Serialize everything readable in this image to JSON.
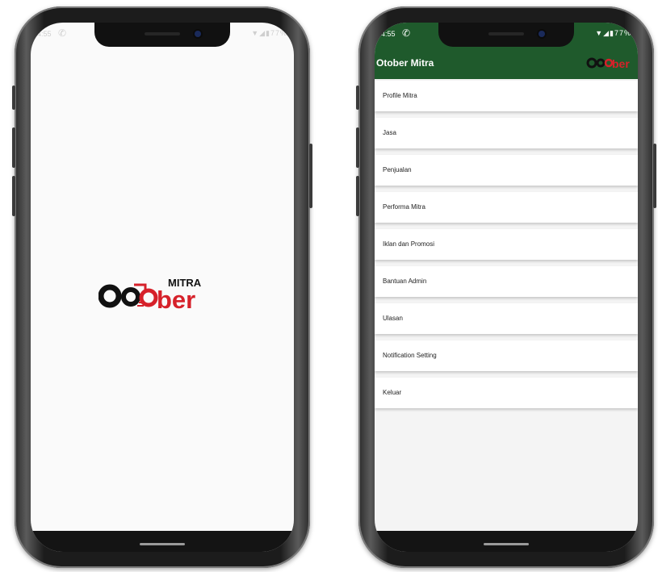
{
  "status_bar": {
    "time": "4:55",
    "battery": "77%",
    "notification_icon": "whatsapp-icon"
  },
  "splash": {
    "logo_word": "Otober",
    "logo_sub": "MITRA"
  },
  "app": {
    "title": "Otober Mitra",
    "menu": [
      {
        "label": "Profile Mitra"
      },
      {
        "label": "Jasa"
      },
      {
        "label": "Penjualan"
      },
      {
        "label": "Performa Mitra"
      },
      {
        "label": "Iklan dan Promosi"
      },
      {
        "label": "Bantuan Admin"
      },
      {
        "label": "Ulasan"
      },
      {
        "label": "Notification Setting"
      },
      {
        "label": "Keluar"
      }
    ]
  },
  "colors": {
    "appbar": "#1f5a2c",
    "logo_black": "#111111",
    "logo_red": "#d6212a"
  }
}
